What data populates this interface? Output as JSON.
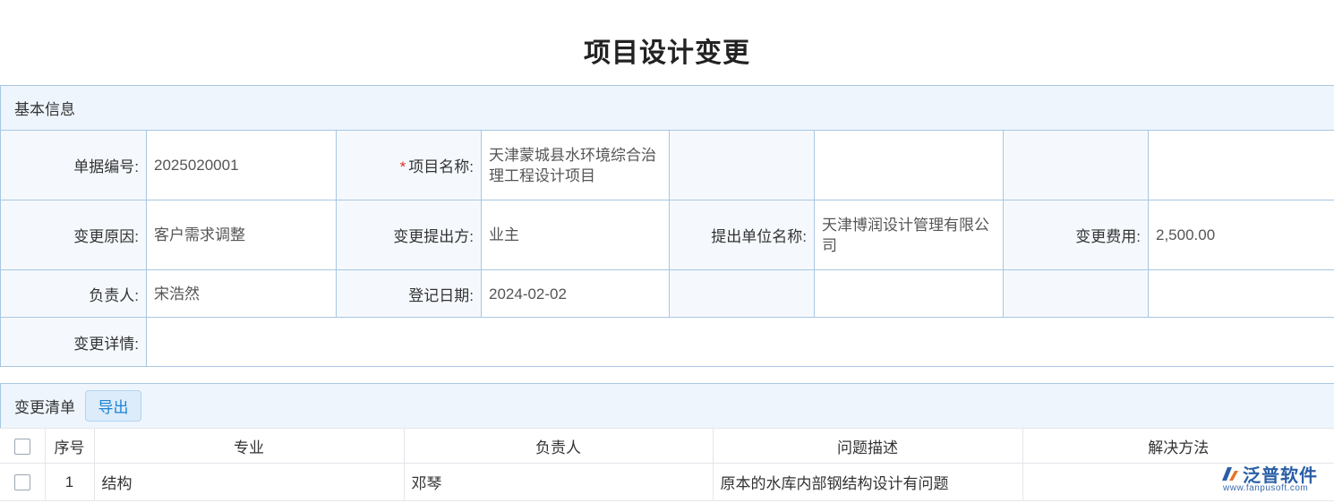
{
  "page_title": "项目设计变更",
  "basic_info": {
    "section_title": "基本信息",
    "fields": {
      "doc_no_label": "单据编号:",
      "doc_no_value": "2025020001",
      "required_mark": "*",
      "project_name_label": "项目名称:",
      "project_name_value": "天津蒙城县水环境综合治理工程设计项目",
      "change_reason_label": "变更原因:",
      "change_reason_value": "客户需求调整",
      "change_proposer_label": "变更提出方:",
      "change_proposer_value": "业主",
      "proposer_unit_label": "提出单位名称:",
      "proposer_unit_value": "天津博润设计管理有限公司",
      "change_cost_label": "变更费用:",
      "change_cost_value": "2,500.00",
      "owner_label": "负责人:",
      "owner_value": "宋浩然",
      "register_date_label": "登记日期:",
      "register_date_value": "2024-02-02",
      "change_detail_label": "变更详情:",
      "change_detail_value": ""
    }
  },
  "change_list": {
    "section_title": "变更清单",
    "export_label": "导出",
    "columns": [
      "序号",
      "专业",
      "负责人",
      "问题描述",
      "解决方法"
    ],
    "rows": [
      {
        "index": "1",
        "discipline": "结构",
        "owner": "邓琴",
        "issue": "原本的水库内部钢结构设计有问题",
        "solution": ""
      }
    ]
  },
  "brand": {
    "name": "泛普软件",
    "url": "www.fanpusoft.com",
    "color": "#2a5fa6"
  }
}
